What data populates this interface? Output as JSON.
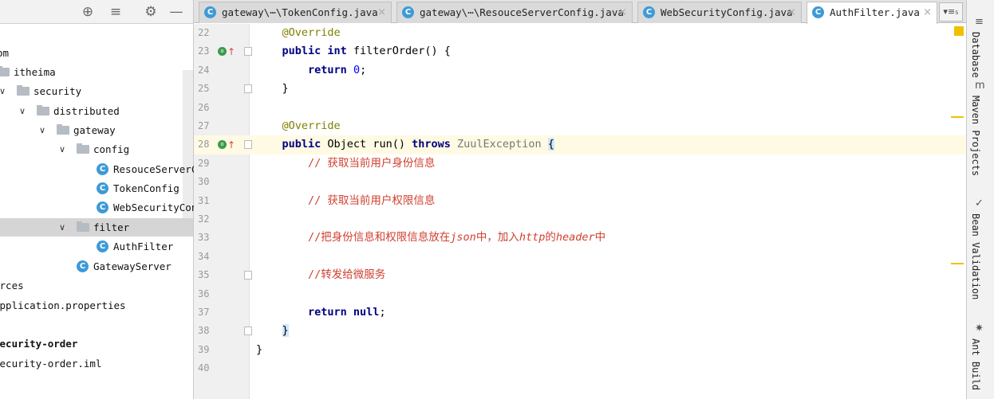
{
  "tree": [
    {
      "label": "om",
      "level": 0,
      "type": "text"
    },
    {
      "label": "itheima",
      "level": 0,
      "type": "folder",
      "arrow": false
    },
    {
      "label": "security",
      "level": 1,
      "type": "folder",
      "arrow": true
    },
    {
      "label": "distributed",
      "level": 2,
      "type": "folder",
      "arrow": true
    },
    {
      "label": "gateway",
      "level": 3,
      "type": "folder",
      "arrow": true
    },
    {
      "label": "config",
      "level": 4,
      "type": "folder",
      "arrow": true
    },
    {
      "label": "ResouceServerConfig",
      "level": 5,
      "type": "class"
    },
    {
      "label": "TokenConfig",
      "level": 5,
      "type": "class"
    },
    {
      "label": "WebSecurityConfig",
      "level": 5,
      "type": "class"
    },
    {
      "label": "filter",
      "level": 4,
      "type": "folder",
      "arrow": true,
      "selected": true
    },
    {
      "label": "AuthFilter",
      "level": 5,
      "type": "class"
    },
    {
      "label": "GatewayServer",
      "level": 4,
      "type": "class"
    },
    {
      "label": "urces",
      "level": -1,
      "type": "text"
    },
    {
      "label": "application.properties",
      "level": -1,
      "type": "text"
    },
    {
      "label": "",
      "level": -1,
      "type": "text"
    },
    {
      "label": "security-order",
      "level": -1,
      "type": "text",
      "bold": true
    },
    {
      "label": "security-order.iml",
      "level": -1,
      "type": "text"
    }
  ],
  "tabs": [
    {
      "label": "gateway\\⋯\\TokenConfig.java",
      "active": false
    },
    {
      "label": "gateway\\⋯\\ResouceServerConfig.java",
      "active": false
    },
    {
      "label": "WebSecurityConfig.java",
      "active": false
    },
    {
      "label": "AuthFilter.java",
      "active": true
    }
  ],
  "tabs_more_label": "▾≡₅",
  "right_tools": [
    "Database",
    "Maven Projects",
    "Bean Validation",
    "Ant Build"
  ],
  "current_line": 28,
  "code": [
    {
      "n": 22,
      "tokens": [
        [
          "    ",
          ""
        ],
        [
          "@Override",
          "ann"
        ]
      ]
    },
    {
      "n": 23,
      "gutter": true,
      "fold": true,
      "tokens": [
        [
          "    ",
          ""
        ],
        [
          "public int ",
          "kw"
        ],
        [
          "filterOrder() {",
          "pl"
        ]
      ]
    },
    {
      "n": 24,
      "tokens": [
        [
          "        ",
          ""
        ],
        [
          "return ",
          "kw"
        ],
        [
          "0",
          "num"
        ],
        [
          ";",
          "pl"
        ]
      ]
    },
    {
      "n": 25,
      "fold": true,
      "tokens": [
        [
          "    ",
          ""
        ],
        [
          "}",
          "pl"
        ]
      ]
    },
    {
      "n": 26,
      "tokens": []
    },
    {
      "n": 27,
      "tokens": [
        [
          "    ",
          ""
        ],
        [
          "@Override",
          "ann"
        ]
      ]
    },
    {
      "n": 28,
      "gutter": true,
      "fold": true,
      "tokens": [
        [
          "    ",
          ""
        ],
        [
          "public ",
          "kw"
        ],
        [
          "Object run() ",
          "pl"
        ],
        [
          "throws ",
          "kw"
        ],
        [
          "ZuulException ",
          "typ"
        ],
        [
          "{",
          "pl brace-hl"
        ]
      ]
    },
    {
      "n": 29,
      "tokens": [
        [
          "        ",
          ""
        ],
        [
          "// 获取当前用户身份信息",
          "cm"
        ]
      ]
    },
    {
      "n": 30,
      "tokens": []
    },
    {
      "n": 31,
      "tokens": [
        [
          "        ",
          ""
        ],
        [
          "// 获取当前用户权限信息",
          "cm"
        ]
      ]
    },
    {
      "n": 32,
      "tokens": []
    },
    {
      "n": 33,
      "tokens": [
        [
          "        ",
          ""
        ],
        [
          "//把身份信息和权限信息放在",
          "cm"
        ],
        [
          "json",
          "cmi"
        ],
        [
          "中，加入",
          "cm"
        ],
        [
          "http",
          "cmi"
        ],
        [
          "的",
          "cm"
        ],
        [
          "header",
          "cmi"
        ],
        [
          "中",
          "cm"
        ]
      ]
    },
    {
      "n": 34,
      "tokens": []
    },
    {
      "n": 35,
      "fold": true,
      "tokens": [
        [
          "        ",
          ""
        ],
        [
          "//转发给微服务",
          "cm"
        ]
      ]
    },
    {
      "n": 36,
      "tokens": []
    },
    {
      "n": 37,
      "tokens": [
        [
          "        ",
          ""
        ],
        [
          "return null",
          "kw"
        ],
        [
          ";",
          "pl"
        ]
      ]
    },
    {
      "n": 38,
      "fold": true,
      "tokens": [
        [
          "    ",
          ""
        ],
        [
          "}",
          "pl brace-hl"
        ]
      ]
    },
    {
      "n": 39,
      "tokens": [
        [
          "}",
          "pl"
        ]
      ]
    },
    {
      "n": 40,
      "tokens": []
    }
  ]
}
